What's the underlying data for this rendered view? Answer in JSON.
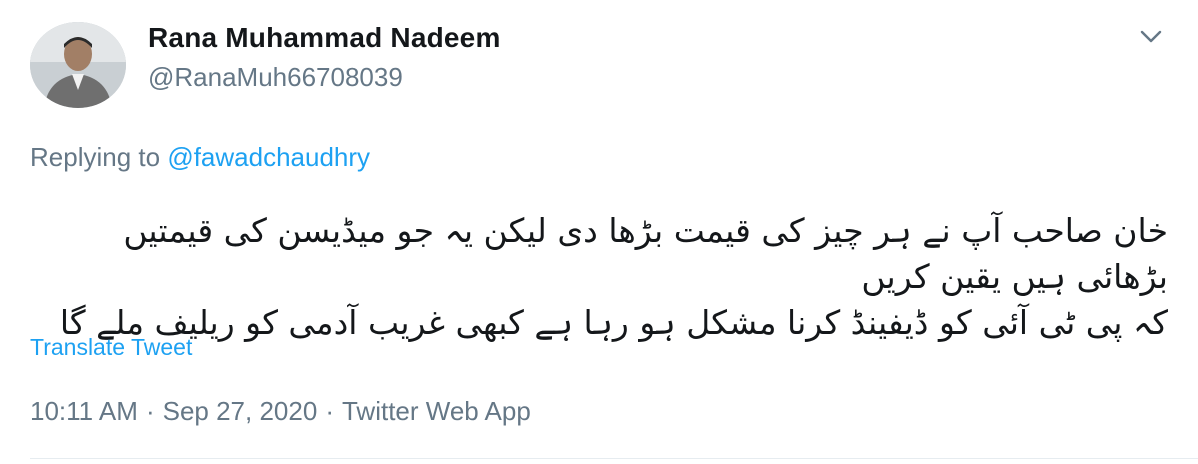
{
  "tweet": {
    "author_name": "Rana Muhammad Nadeem",
    "author_handle": "@RanaMuh66708039",
    "replying_prefix": "Replying to ",
    "replying_to": "@fawadchaudhry",
    "text_line1": "خان صاحب آپ نے ہر چیز کی قیمت بڑھا دی لیکن یہ جو میڈیسن کی قیمتیں بڑھائی  ہیں یقین کریں",
    "text_line2": "کہ پی ٹی آئی کو ڈیفینڈ کرنا مشکل ہو رہا ہے کبھی غریب آدمی کو ریلیف ملے گا",
    "translate_label": "Translate Tweet",
    "time": "10:11 AM",
    "separator": "·",
    "date": "Sep 27, 2020",
    "source": "Twitter Web App"
  },
  "icons": {
    "menu": "chevron-down-icon"
  },
  "colors": {
    "link": "#1da1f2",
    "secondary_text": "#657786",
    "primary_text": "#14171a",
    "divider": "#e6ecf0"
  }
}
